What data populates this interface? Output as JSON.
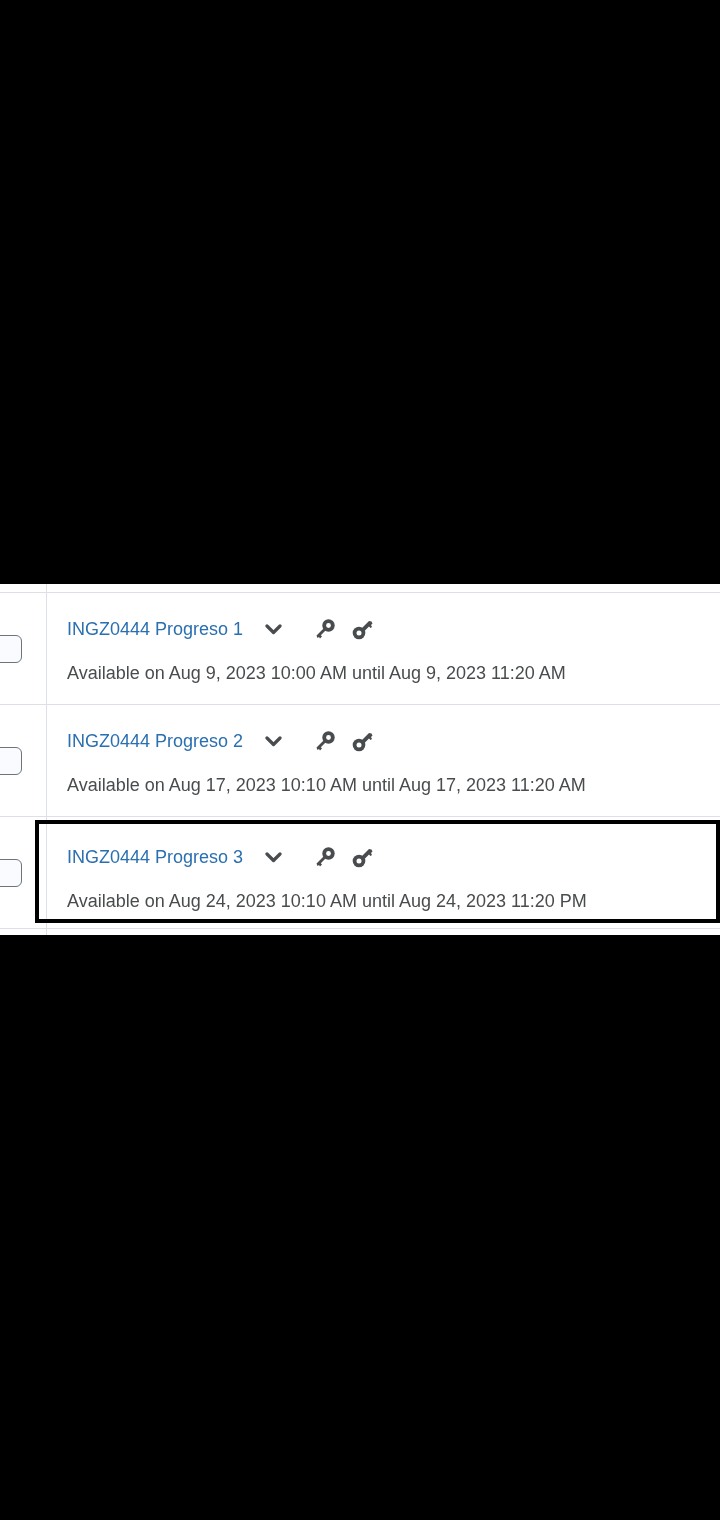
{
  "rows": [
    {
      "title": "INGZ0444 Progreso 1",
      "availability": "Available on Aug 9, 2023 10:00 AM until Aug 9, 2023 11:20 AM",
      "checked": false,
      "highlighted": false
    },
    {
      "title": "INGZ0444 Progreso 2",
      "availability": "Available on Aug 17, 2023 10:10 AM until Aug 17, 2023 11:20 AM",
      "checked": false,
      "highlighted": false
    },
    {
      "title": "INGZ0444 Progreso 3",
      "availability": "Available on Aug 24, 2023 10:10 AM until Aug 24, 2023 11:20 PM",
      "checked": false,
      "highlighted": true
    }
  ]
}
